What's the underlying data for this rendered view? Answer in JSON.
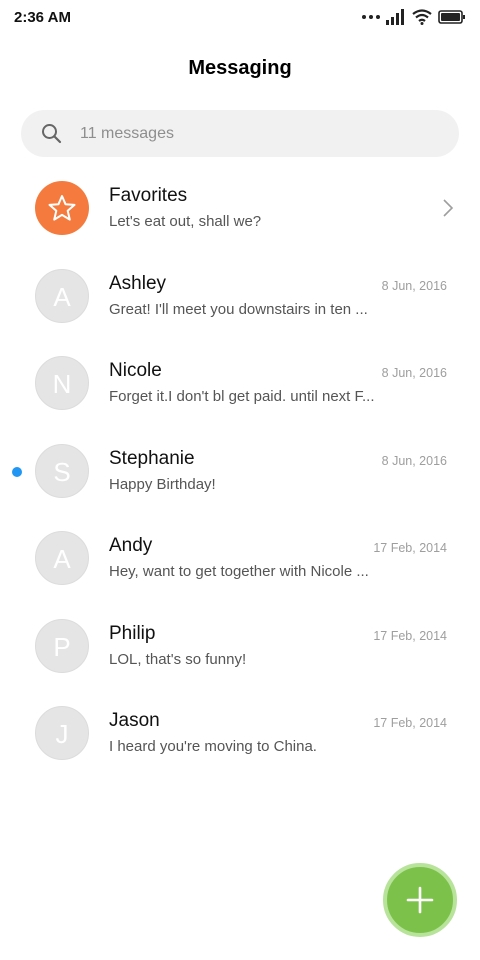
{
  "status_bar": {
    "time": "2:36 AM"
  },
  "header": {
    "title": "Messaging"
  },
  "search": {
    "placeholder": "11 messages"
  },
  "conversations": [
    {
      "name": "Favorites",
      "preview": "Let's eat out, shall we?",
      "avatar_icon": "star-icon",
      "accent": "#f47b3d"
    },
    {
      "name": "Ashley",
      "initial": "A",
      "preview": "Great! I'll meet you downstairs in ten ...",
      "timestamp": "8 Jun, 2016"
    },
    {
      "name": "Nicole",
      "initial": "N",
      "preview": "Forget it.I don't bl get paid. until next F...",
      "timestamp": "8 Jun, 2016"
    },
    {
      "name": "Stephanie",
      "initial": "S",
      "preview": "Happy Birthday!",
      "timestamp": "8 Jun, 2016",
      "unread": true,
      "unread_color": "#2196f3"
    },
    {
      "name": "Andy",
      "initial": "A",
      "preview": "Hey, want to get together with Nicole ...",
      "timestamp": "17 Feb, 2014"
    },
    {
      "name": "Philip",
      "initial": "P",
      "preview": "LOL, that's so funny!",
      "timestamp": "17 Feb, 2014"
    },
    {
      "name": "Jason",
      "initial": "J",
      "preview": "I heard you're moving to China.",
      "timestamp": "17 Feb, 2014"
    }
  ],
  "fab": {
    "icon": "plus-icon",
    "color": "#7cc24a"
  }
}
